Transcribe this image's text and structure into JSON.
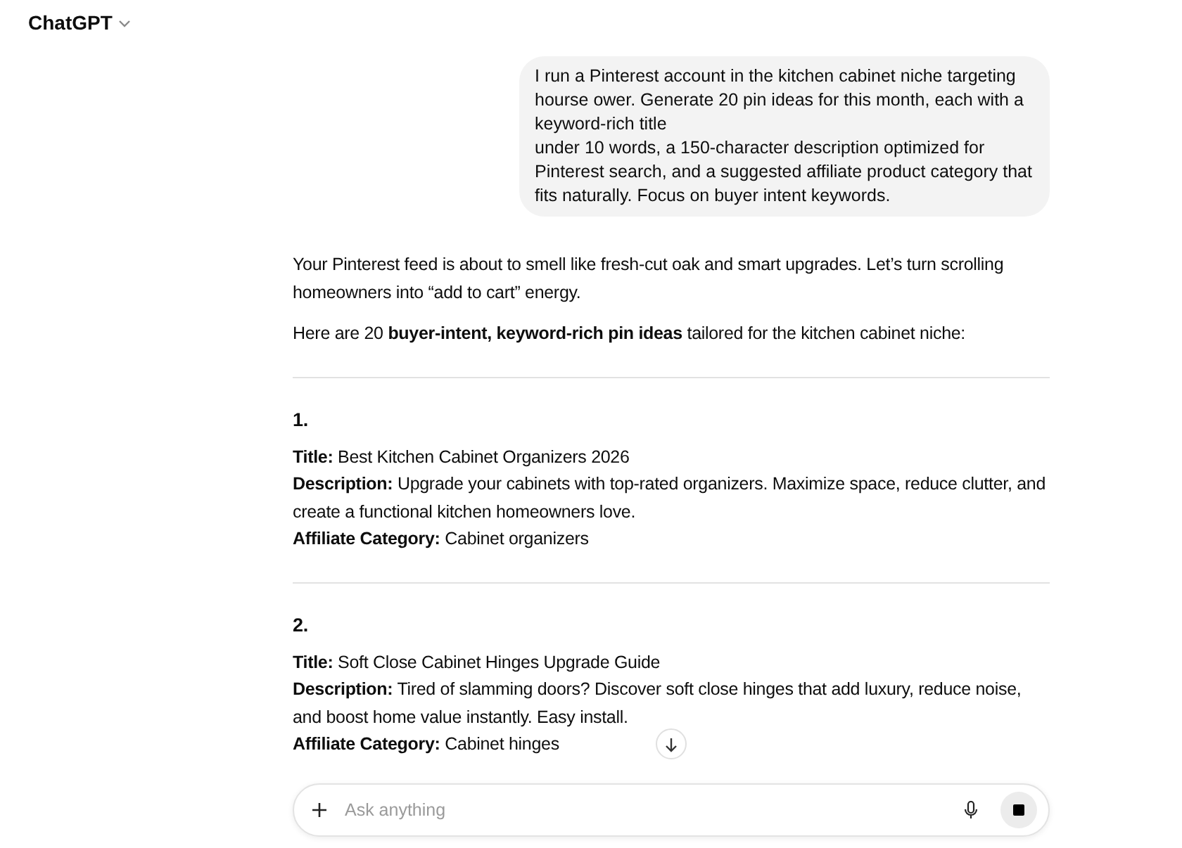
{
  "header": {
    "title": "ChatGPT"
  },
  "user_message": [
    "I run a Pinterest account in the kitchen cabinet niche targeting hourse ower. Generate 20 pin ideas for this month, each with a keyword-rich title",
    "under 10 words, a 150-character description optimized for Pinterest search, and a suggested affiliate product category that fits naturally. Focus on buyer intent keywords."
  ],
  "assistant_message": {
    "paragraphs": [
      "Your Pinterest feed is about to smell like fresh-cut oak and smart upgrades. Let’s turn scrolling homeowners into “add to cart” energy.",
      "Here are 20 **buyer-intent, keyword-rich pin ideas** tailored for the kitchen cabinet niche:"
    ],
    "items": [
      {
        "number": "1.",
        "lines": [
          "**Title:** Best Kitchen Cabinet Organizers 2026",
          "**Description:** Upgrade your cabinets with top-rated organizers. Maximize space, reduce clutter, and create a functional kitchen homeowners love.",
          "**Affiliate Category:** Cabinet organizers"
        ]
      },
      {
        "number": "2.",
        "lines": [
          "**Title:** Soft Close Cabinet Hinges Upgrade Guide",
          "**Description:** Tired of slamming doors? Discover soft close hinges that add luxury, reduce noise, and boost home value instantly. Easy install.",
          "**Affiliate Category:** Cabinet hinges"
        ]
      }
    ]
  },
  "composer": {
    "placeholder": "Ask anything"
  }
}
